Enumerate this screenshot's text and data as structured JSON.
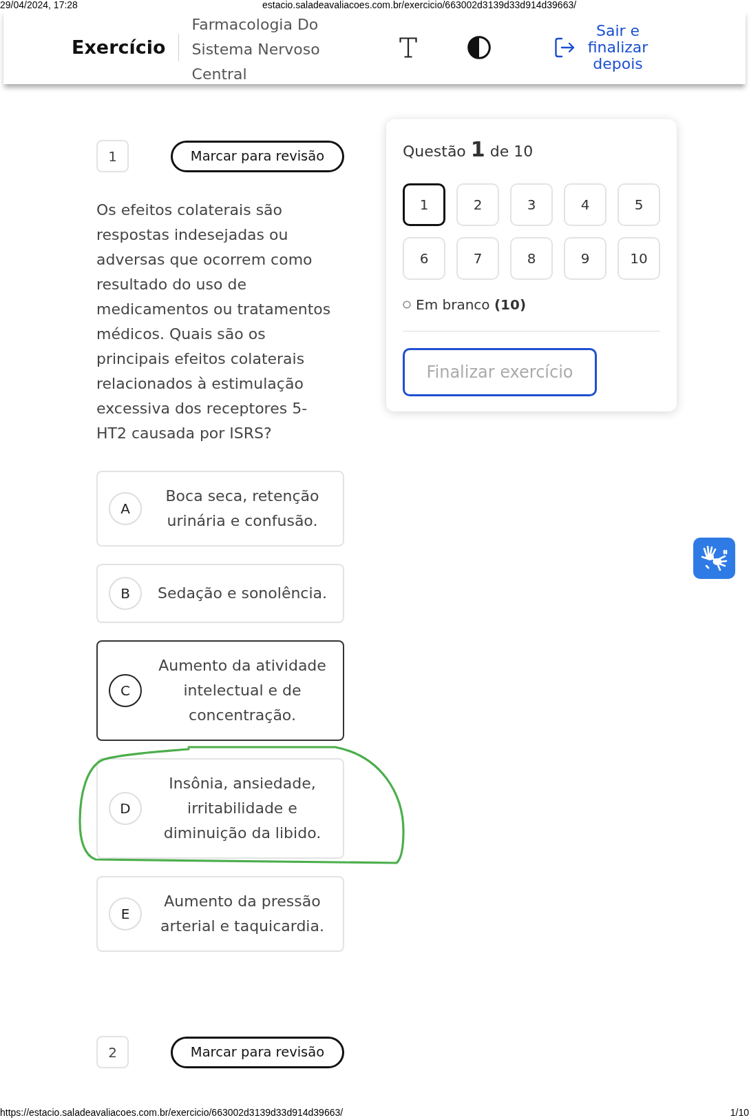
{
  "print_header": {
    "date": "29/04/2024, 17:28",
    "url": "estacio.saladeavaliacoes.com.br/exercicio/663002d3139d33d914d39663/"
  },
  "header": {
    "title": "Exercício",
    "subtitle": "Farmacologia Do Sistema Nervoso Central",
    "exit_link": "Sair e finalizar depois"
  },
  "questions": [
    {
      "number": "1",
      "review_button": "Marcar para revisão",
      "text": "Os efeitos colaterais são respostas indesejadas ou adversas que ocorrem como resultado do uso de medicamentos ou tratamentos médicos. Quais são os principais efeitos colaterais relacionados à estimulação excessiva dos receptores 5-HT2 causada por ISRS?",
      "options": [
        {
          "letter": "A",
          "text": "Boca seca, retenção urinária e confusão.",
          "selected": false,
          "circled": false
        },
        {
          "letter": "B",
          "text": "Sedação e sonolência.",
          "selected": false,
          "circled": false
        },
        {
          "letter": "C",
          "text": "Aumento da atividade intelectual e de concentração.",
          "selected": true,
          "circled": false
        },
        {
          "letter": "D",
          "text": "Insônia, ansiedade, irritabilidade e diminuição da libido.",
          "selected": false,
          "circled": true
        },
        {
          "letter": "E",
          "text": "Aumento da pressão arterial e taquicardia.",
          "selected": false,
          "circled": false
        }
      ]
    },
    {
      "number": "2",
      "review_button": "Marcar para revisão"
    }
  ],
  "navigator": {
    "title": "Questão **1** de 10",
    "items": [
      {
        "label": "1",
        "selected": true
      },
      {
        "label": "2",
        "selected": false
      },
      {
        "label": "3",
        "selected": false
      },
      {
        "label": "4",
        "selected": false
      },
      {
        "label": "5",
        "selected": false
      },
      {
        "label": "6",
        "selected": false
      },
      {
        "label": "7",
        "selected": false
      },
      {
        "label": "8",
        "selected": false
      },
      {
        "label": "9",
        "selected": false
      },
      {
        "label": "10",
        "selected": false
      }
    ],
    "legend": "Em branco **(10)**",
    "finish_button": {
      "label": "Finalizar exercício",
      "disabled": true
    }
  },
  "print_footer": {
    "url": "https://estacio.saladeavaliacoes.com.br/exercicio/663002d3139d33d914d39663/",
    "page": "1/10"
  }
}
